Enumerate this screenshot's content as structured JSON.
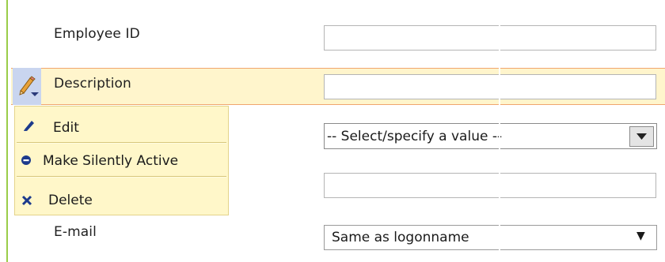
{
  "form": {
    "employee_id_label": "Employee ID",
    "employee_id_value": "",
    "description_label": "Description",
    "description_value": "",
    "select_value": "-- Select/specify a value --",
    "text_field_value": "",
    "email_label": "E-mail",
    "email_value": "Same as logonname",
    "email_arrow": "▼"
  },
  "context_menu": {
    "items": [
      {
        "label": "Edit",
        "icon": "pencil-icon"
      },
      {
        "label": "Make Silently Active",
        "icon": "circle-dot-icon"
      },
      {
        "label": "Delete",
        "icon": "x-icon"
      }
    ]
  },
  "colors": {
    "highlight_bg": "#fff5cc",
    "highlight_border": "#f0a66e",
    "menu_bg": "#fff7c9",
    "icon_blue": "#1c3a8c",
    "left_rule": "#9acd48"
  }
}
